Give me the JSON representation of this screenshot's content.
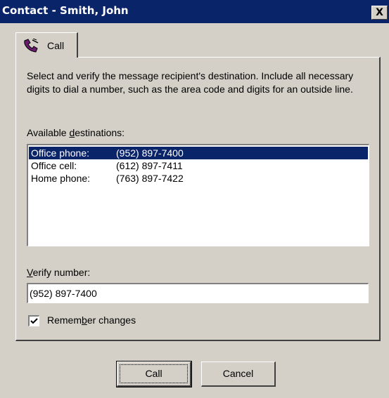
{
  "window": {
    "title": "Contact - Smith, John",
    "close_label": "X"
  },
  "tab": {
    "label": "Call",
    "icon": "phone-handset-icon"
  },
  "instructions": "Select and verify the message recipient's destination. Include all necessary digits to dial a number, such as the area code and digits for an outside line.",
  "destinations": {
    "label_pre": "Available ",
    "label_accel": "d",
    "label_post": "estinations:",
    "items": [
      {
        "type": "Office phone:",
        "number": "(952) 897-7400",
        "selected": true
      },
      {
        "type": "Office cell:",
        "number": "(612) 897-7411",
        "selected": false
      },
      {
        "type": "Home phone:",
        "number": "(763) 897-7422",
        "selected": false
      }
    ]
  },
  "verify": {
    "label_accel": "V",
    "label_post": "erify number:",
    "value": "(952) 897-7400"
  },
  "remember": {
    "label_pre": "Remem",
    "label_accel": "b",
    "label_post": "er changes",
    "checked": true
  },
  "buttons": {
    "call": "Call",
    "cancel": "Cancel"
  },
  "colors": {
    "title_bar": "#0a246a",
    "face": "#d4d0c8",
    "selection": "#0a246a",
    "tab_icon_purple": "#6a1b6e"
  }
}
